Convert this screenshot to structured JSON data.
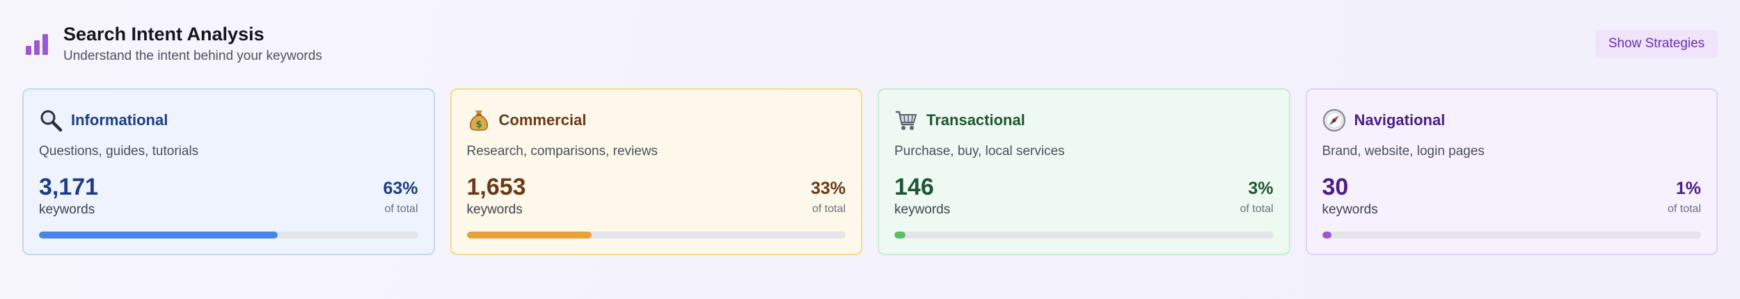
{
  "header": {
    "title": "Search Intent Analysis",
    "subtitle": "Understand the intent behind your keywords",
    "icon": "bar-chart-icon",
    "button_label": "Show Strategies"
  },
  "colors": {
    "accent": "#9b59d0",
    "informational": "#4a84e8",
    "commercial": "#e8a23a",
    "transactional": "#5bbf6a",
    "navigational": "#9b59d0",
    "bar_track": "#e4e5ea"
  },
  "cards": [
    {
      "key": "informational",
      "icon": "magnifying-glass-icon",
      "title": "Informational",
      "description": "Questions, guides, tutorials",
      "count": "3,171",
      "count_label": "keywords",
      "percent": "63%",
      "percent_label": "of total",
      "fraction": 0.63
    },
    {
      "key": "commercial",
      "icon": "money-bag-icon",
      "title": "Commercial",
      "description": "Research, comparisons, reviews",
      "count": "1,653",
      "count_label": "keywords",
      "percent": "33%",
      "percent_label": "of total",
      "fraction": 0.33
    },
    {
      "key": "transactional",
      "icon": "shopping-cart-icon",
      "title": "Transactional",
      "description": "Purchase, buy, local services",
      "count": "146",
      "count_label": "keywords",
      "percent": "3%",
      "percent_label": "of total",
      "fraction": 0.03
    },
    {
      "key": "navigational",
      "icon": "compass-icon",
      "title": "Navigational",
      "description": "Brand, website, login pages",
      "count": "30",
      "count_label": "keywords",
      "percent": "1%",
      "percent_label": "of total",
      "fraction": 0.01
    }
  ]
}
